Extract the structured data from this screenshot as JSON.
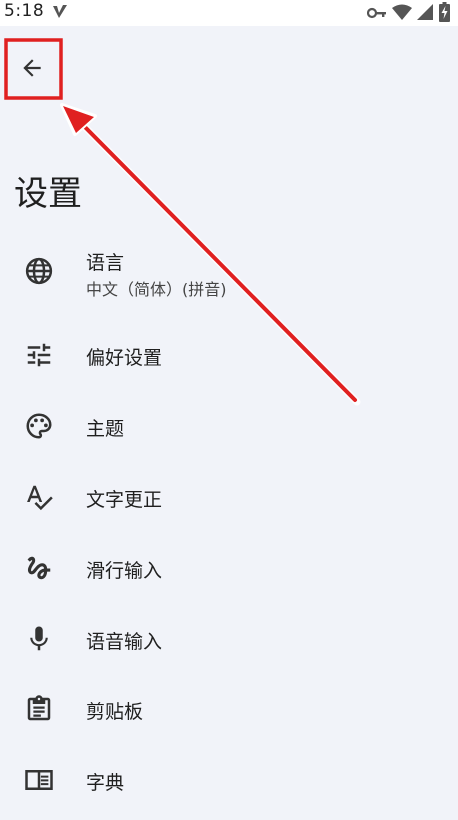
{
  "status_bar": {
    "time": "5:18",
    "icons": [
      "check-v-icon",
      "vpn-key-icon",
      "wifi-icon",
      "signal-icon",
      "battery-charging-icon"
    ]
  },
  "toolbar": {
    "back_icon": "arrow-left-icon"
  },
  "page": {
    "title": "设置"
  },
  "settings": [
    {
      "icon": "globe-icon",
      "label": "语言",
      "summary": "中文（简体）(拼音)"
    },
    {
      "icon": "sliders-icon",
      "label": "偏好设置"
    },
    {
      "icon": "palette-icon",
      "label": "主题"
    },
    {
      "icon": "spellcheck-icon",
      "label": "文字更正"
    },
    {
      "icon": "gesture-icon",
      "label": "滑行输入"
    },
    {
      "icon": "mic-icon",
      "label": "语音输入"
    },
    {
      "icon": "clipboard-icon",
      "label": "剪贴板"
    },
    {
      "icon": "dictionary-icon",
      "label": "字典"
    }
  ],
  "annotation": {
    "highlight_color": "#e02020",
    "arrow_color": "#e02020"
  }
}
